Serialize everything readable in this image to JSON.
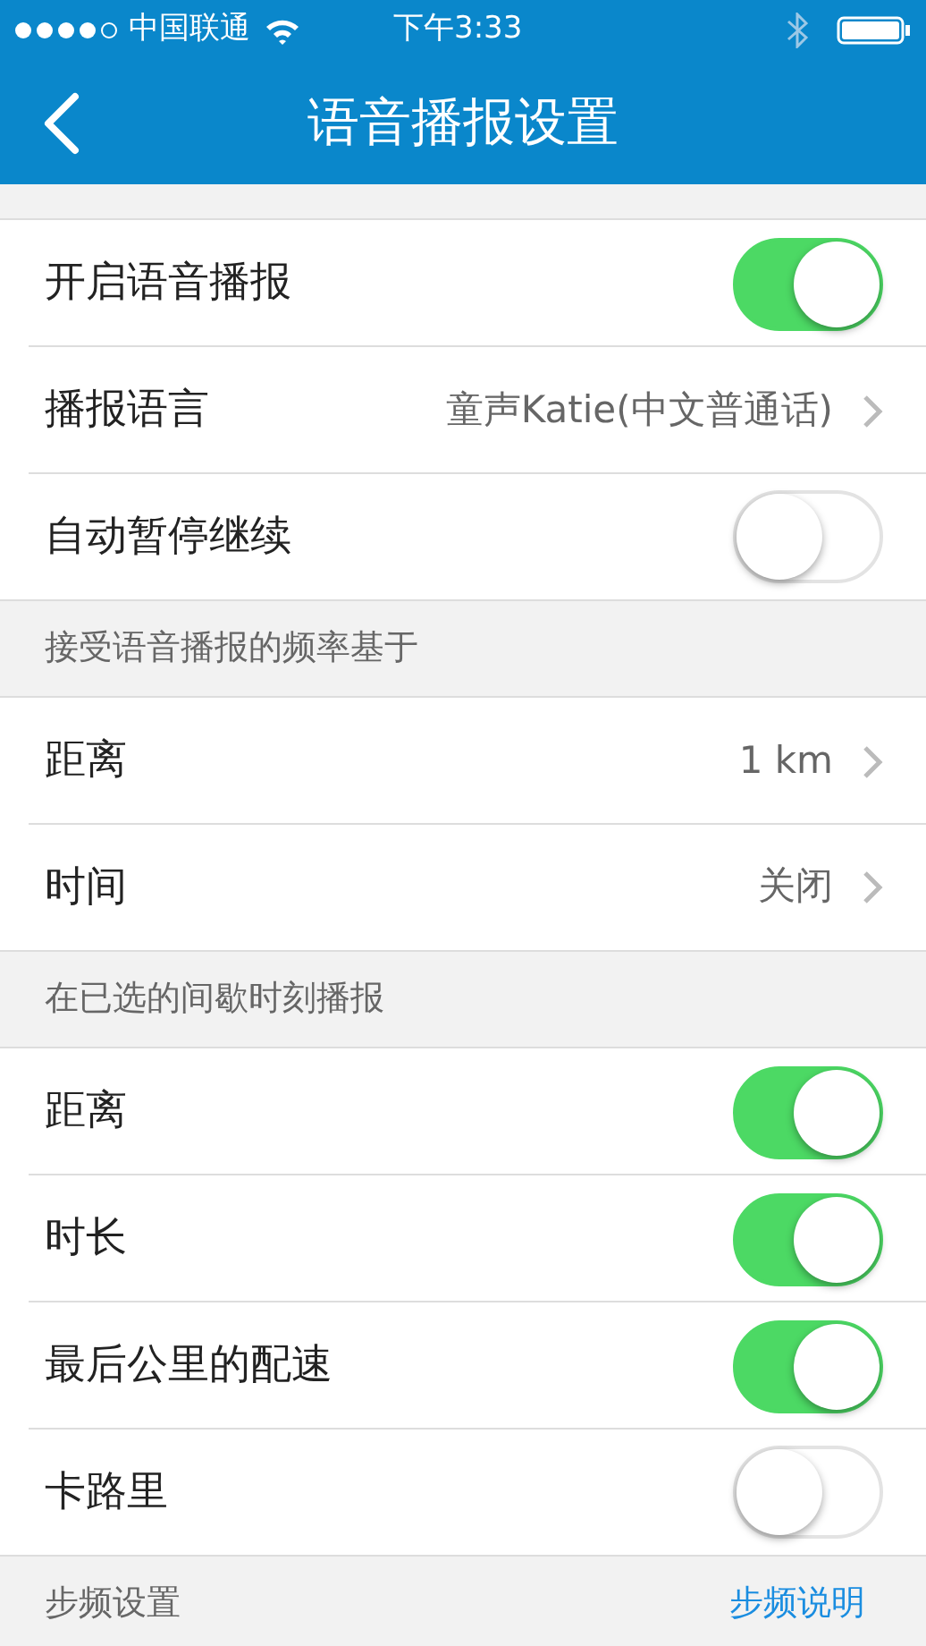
{
  "status_bar": {
    "carrier": "中国联通",
    "time": "下午3:33"
  },
  "nav": {
    "title": "语音播报设置"
  },
  "sections": [
    {
      "rows": [
        {
          "kind": "toggle",
          "label": "开启语音播报",
          "on": true
        },
        {
          "kind": "detail",
          "label": "播报语言",
          "value": "童声Katie(中文普通话)"
        },
        {
          "kind": "toggle",
          "label": "自动暂停继续",
          "on": false
        }
      ]
    },
    {
      "header": "接受语音播报的频率基于",
      "rows": [
        {
          "kind": "detail",
          "label": "距离",
          "value": "1 km"
        },
        {
          "kind": "detail",
          "label": "时间",
          "value": "关闭"
        }
      ]
    },
    {
      "header": "在已选的间歇时刻播报",
      "rows": [
        {
          "kind": "toggle",
          "label": "距离",
          "on": true
        },
        {
          "kind": "toggle",
          "label": "时长",
          "on": true
        },
        {
          "kind": "toggle",
          "label": "最后公里的配速",
          "on": true
        },
        {
          "kind": "toggle",
          "label": "卡路里",
          "on": false
        }
      ]
    },
    {
      "header": "步频设置",
      "link": "步频说明"
    }
  ]
}
